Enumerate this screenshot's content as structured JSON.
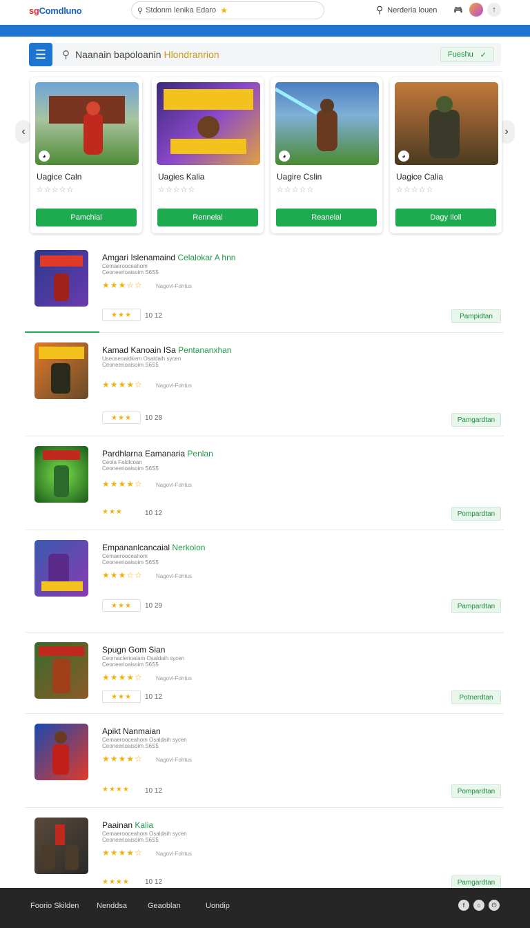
{
  "header": {
    "logo_prefix": "sg",
    "logo_text": "Comdluno",
    "top_search_text": "Stdonm lenika Edaro",
    "right_search_text": "Nerderia louen"
  },
  "toolbar": {
    "search_text_main": "Naanain bapoloanin ",
    "search_text_highlight": "Hlondranrion",
    "filter_label": "Fueshu"
  },
  "carousel": {
    "cards": [
      {
        "title": "Uagice Caln",
        "rating": "☆☆☆☆☆",
        "button": "Pamchial"
      },
      {
        "title": "Uagies Kalia",
        "rating": "☆☆☆☆☆",
        "button": "Rennelal"
      },
      {
        "title": "Uagire Cslin",
        "rating": "☆☆☆☆☆",
        "button": "Reanelal"
      },
      {
        "title": "Uagice Calia",
        "rating": "☆☆☆☆☆",
        "button": "Dagy Iloll"
      }
    ]
  },
  "list": [
    {
      "title_main": "Amgari Islenamaind ",
      "title_green": "Celalokar A hnn",
      "sub1": "Cemaerooceahom",
      "sub2": "Ceoneerioaisoim  S6S5",
      "stars": "★★★☆☆",
      "votes": "Nagovl-Fohtus",
      "rate_box": "★★★",
      "count": "10 12",
      "button": "Pampidtan"
    },
    {
      "title_main": "Kamad Kanoain ISa ",
      "title_green": "Pentananxhan",
      "sub1": "Useoseoaidkem  Osaldaih sycen",
      "sub2": "Ceoneerioaisoim  S6S5",
      "stars": "★★★★☆",
      "votes": "Nagovl-Fohtus",
      "rate_box": "★★★",
      "count": "10 28",
      "button": "Pamgardtan"
    },
    {
      "title_main": "Pardhlarna Eamanaria ",
      "title_green": "Penlan",
      "sub1": "Ceola Faldlcoan",
      "sub2": "Ceoneerioaisoim  S6S5",
      "stars": "★★★★☆",
      "votes": "Nagovl-Fohtus",
      "rate_box": "★★★",
      "count": "10 12",
      "button": "Pompardtan"
    },
    {
      "title_main": "Empananlcancaial ",
      "title_green": "Nerkolon",
      "sub1": "Cemaerooceahom",
      "sub2": "Ceoneerioaisoim  S6S5",
      "stars": "★★★☆☆",
      "votes": "Nagovl-Fohtus",
      "rate_box": "★★★",
      "count": "10 29",
      "button": "Pampardtan"
    },
    {
      "title_main": "Spugn Gom Sian",
      "title_green": "",
      "sub1": "Ceomaclerioalam  Osaldaih sycen",
      "sub2": "Ceoneerioaisoim  S6S5",
      "stars": "★★★★☆",
      "votes": "Nagovl-Fohtus",
      "rate_box": "★★★",
      "count": "10 12",
      "button": "Potnerdtan"
    },
    {
      "title_main": "Apikt Nanmaian",
      "title_green": "",
      "sub1": "Cemaerooceahom  Osaldaih sycen",
      "sub2": "Ceoneerioaisoim  S6S5",
      "stars": "★★★★☆",
      "votes": "Nagovl-Fohtus",
      "rate_box": "★★★★",
      "count": "10 12",
      "button": "Pompardtan"
    },
    {
      "title_main": "Paainan ",
      "title_green": "Kalia",
      "sub1": "Cemaerooceahom  Osaldaih sycen",
      "sub2": "Ceoneerioaisoim  S6S5",
      "stars": "★★★★☆",
      "votes": "Nagovl-Fohtus",
      "rate_box": "★★★★",
      "count": "10 12",
      "button": "Pamgardtan"
    }
  ],
  "footer": {
    "links": [
      "Foorio Skilden",
      "Nenddsa",
      "Geaoblan",
      "Uondip"
    ]
  },
  "colors": {
    "brand_blue": "#1d74d1",
    "action_green": "#1eaa4e",
    "star_gold": "#f0b20a",
    "footer_bg": "#262626"
  },
  "icons": [
    "search-icon",
    "menu-icon",
    "star-icon",
    "game-controller-icon",
    "avatar-icon",
    "upload-icon",
    "chevron-left-icon",
    "chevron-right-icon",
    "check-icon"
  ]
}
